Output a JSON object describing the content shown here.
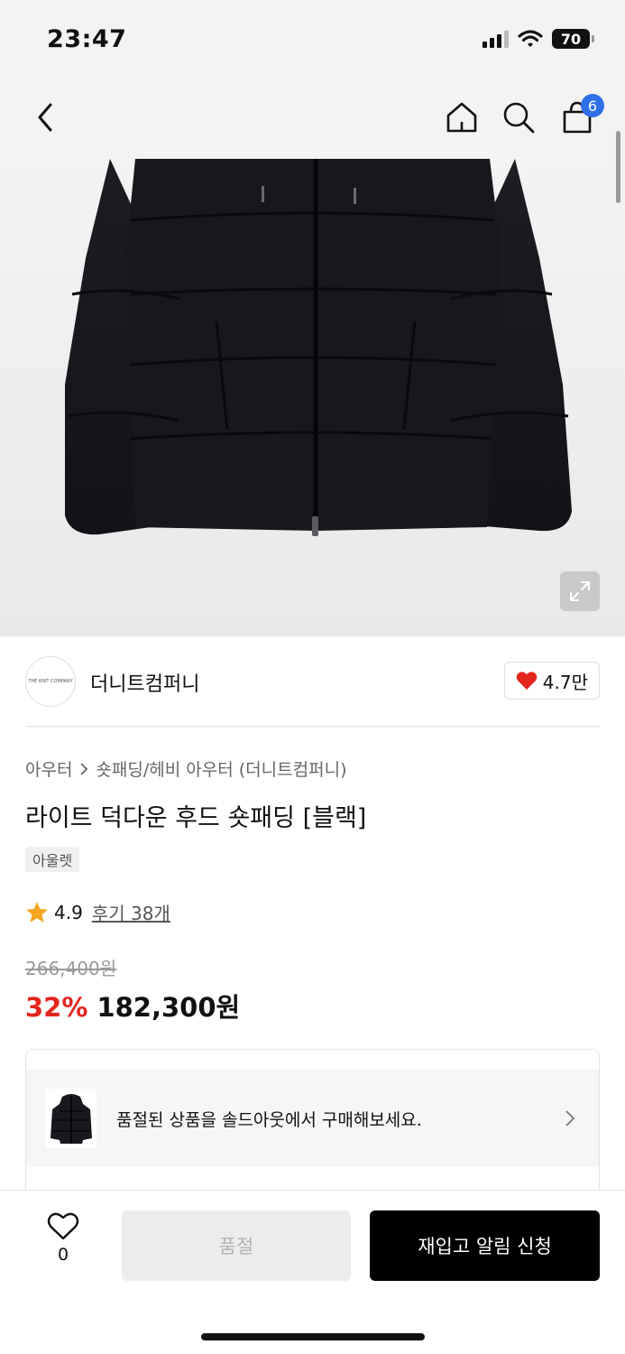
{
  "status_bar": {
    "time": "23:47",
    "battery": "70"
  },
  "nav": {
    "cart_count": "6"
  },
  "brand": {
    "name": "더니트컴퍼니",
    "logo_text": "THE KNIT COMPANY",
    "likes": "4.7만"
  },
  "breadcrumb": {
    "category": "아우터",
    "subcategory": "숏패딩/헤비 아우터 (더니트컴퍼니)"
  },
  "product": {
    "title": "라이트 덕다운 후드 숏패딩 [블랙]",
    "tag": "아울렛",
    "rating": "4.9",
    "review_link": "후기 38개",
    "original_price": "266,400원",
    "discount": "32%",
    "price": "182,300원"
  },
  "soldout_notice": {
    "text": "품절된 상품을 솔드아웃에서 구매해보세요."
  },
  "bottom_bar": {
    "wish_count": "0",
    "soldout_label": "품절",
    "restock_label": "재입고 알림 신청"
  },
  "colors": {
    "accent_blue": "#2f6fe8",
    "discount_red": "#e3261d",
    "heart_red": "#e3261d"
  }
}
